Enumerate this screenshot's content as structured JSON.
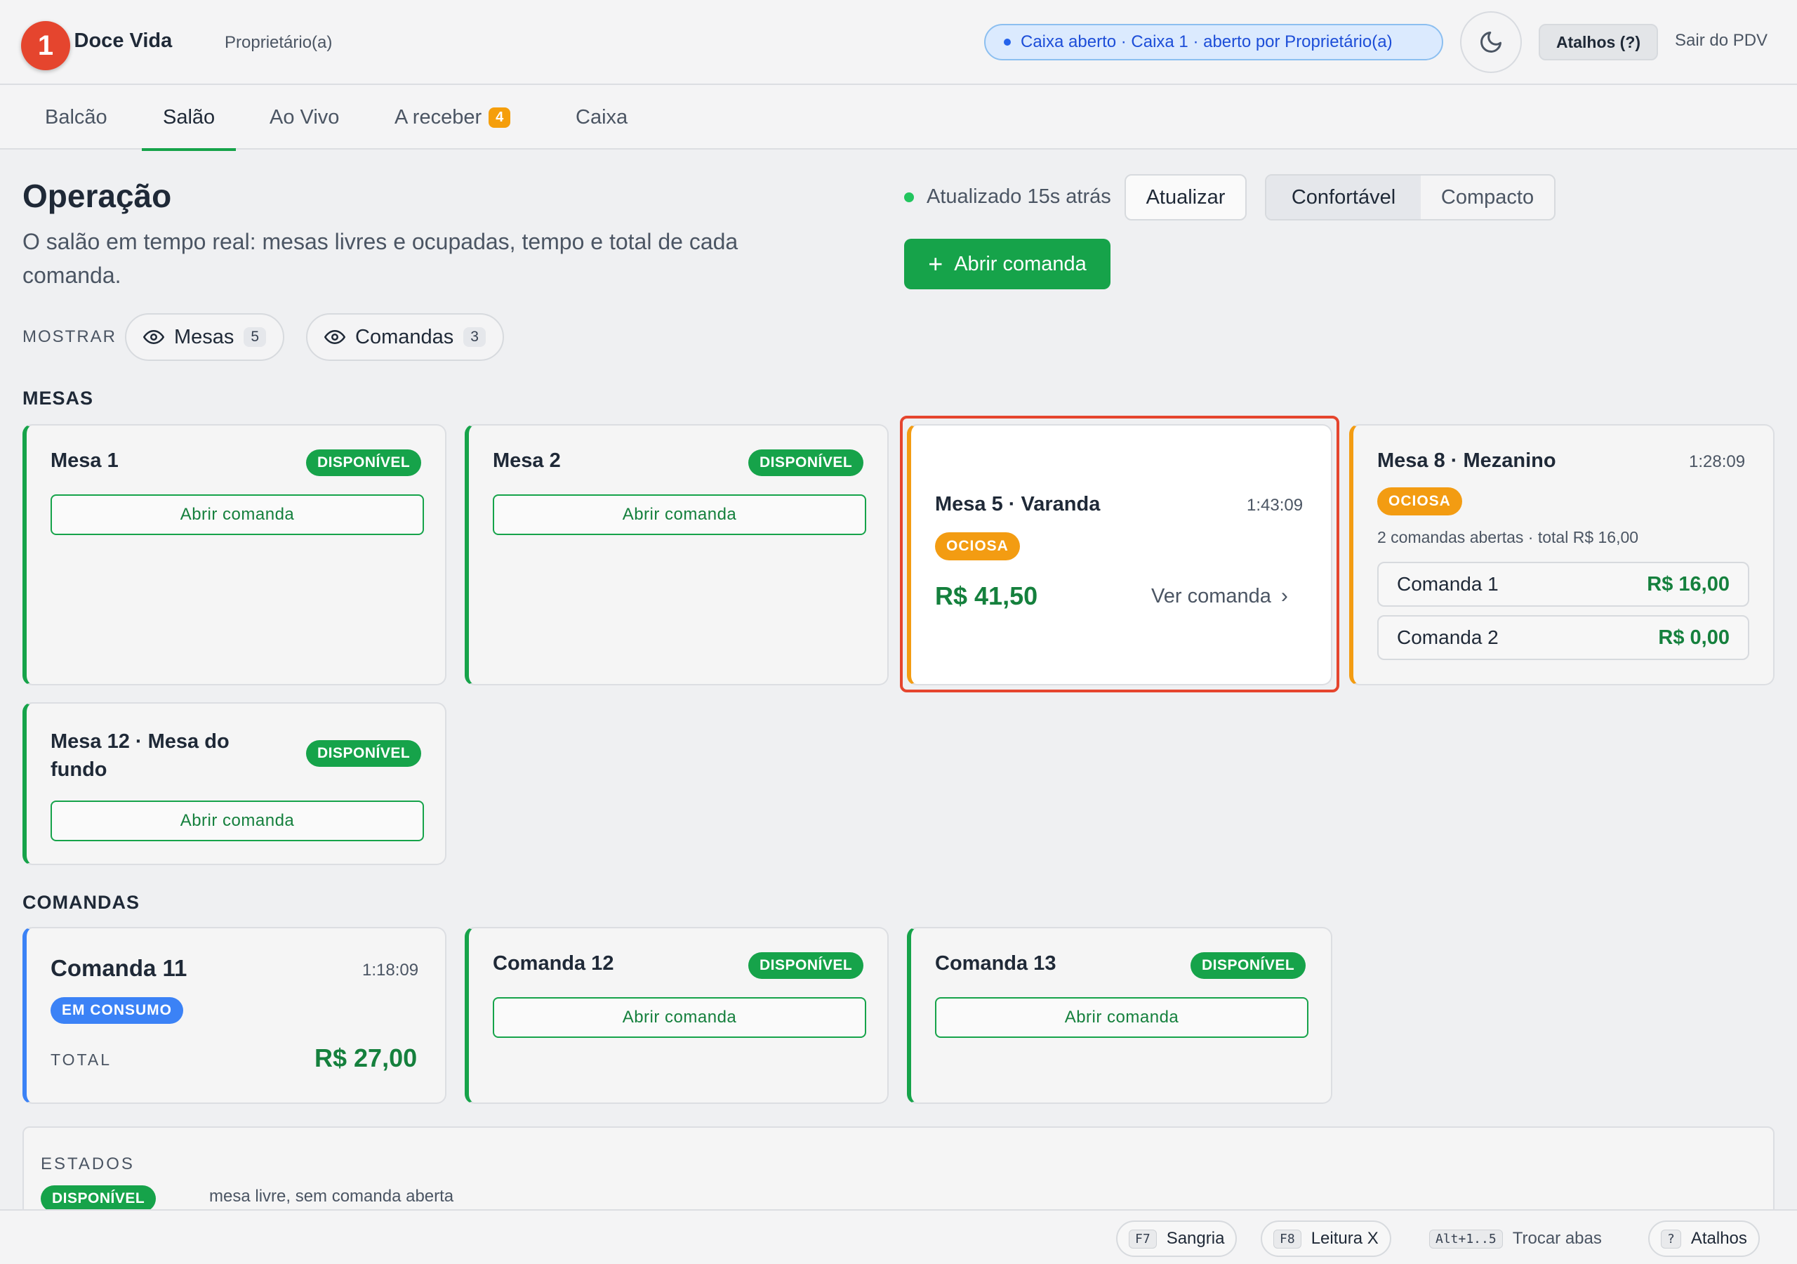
{
  "header": {
    "brand": "ria Doce Vida",
    "role": "Proprietário(a)",
    "step_marker": "1",
    "caixa_status": "Caixa aberto · Caixa 1 · aberto por Proprietário(a)",
    "shortcuts_label": "Atalhos (?)",
    "logout_label": "Sair do PDV"
  },
  "tabs": [
    {
      "label": "Balcão"
    },
    {
      "label": "Salão",
      "active": true
    },
    {
      "label": "Ao Vivo"
    },
    {
      "label": "A receber",
      "badge": "4"
    },
    {
      "label": "Caixa"
    }
  ],
  "page": {
    "title": "Operação",
    "subtitle": "O salão em tempo real: mesas livres e ocupadas, tempo e total de cada comanda.",
    "updated": "Atualizado 15s atrás",
    "refresh_label": "Atualizar",
    "density_options": [
      "Confortável",
      "Compacto"
    ],
    "density_selected": "Confortável",
    "open_comanda_label": "Abrir comanda"
  },
  "filters": {
    "label": "MOSTRAR",
    "mesas": {
      "label": "Mesas",
      "count": "5"
    },
    "comandas": {
      "label": "Comandas",
      "count": "3"
    }
  },
  "mesas_section": "MESAS",
  "mesas": [
    {
      "name": "Mesa 1",
      "status": "DISPONÍVEL",
      "action": "Abrir comanda"
    },
    {
      "name": "Mesa 2",
      "status": "DISPONÍVEL",
      "action": "Abrir comanda"
    },
    {
      "name": "Mesa 5 · Varanda",
      "status": "OCIOSA",
      "time": "1:43:09",
      "total": "R$ 41,50",
      "action": "Ver comanda"
    },
    {
      "name": "Mesa 8 · Mezanino",
      "status": "OCIOSA",
      "time": "1:28:09",
      "summary": "2 comandas abertas · total R$ 16,00",
      "comandas": [
        {
          "name": "Comanda 1",
          "value": "R$ 16,00"
        },
        {
          "name": "Comanda 2",
          "value": "R$ 0,00"
        }
      ]
    },
    {
      "name_line1": "Mesa 12 · Mesa do",
      "name_line2": "fundo",
      "status": "DISPONÍVEL",
      "action": "Abrir comanda"
    }
  ],
  "comandas_section": "COMANDAS",
  "comandas": [
    {
      "name": "Comanda 11",
      "status": "EM CONSUMO",
      "time": "1:18:09",
      "total_label": "TOTAL",
      "total": "R$ 27,00"
    },
    {
      "name": "Comanda 12",
      "status": "DISPONÍVEL",
      "action": "Abrir comanda"
    },
    {
      "name": "Comanda 13",
      "status": "DISPONÍVEL",
      "action": "Abrir comanda"
    }
  ],
  "estados": {
    "label": "ESTADOS",
    "items": [
      {
        "status": "DISPONÍVEL",
        "desc": "mesa livre, sem comanda aberta"
      }
    ]
  },
  "footer": {
    "sangria": {
      "key": "F7",
      "label": "Sangria"
    },
    "leitura": {
      "key": "F8",
      "label": "Leitura X"
    },
    "trocar": {
      "key": "Alt+1..5",
      "label": "Trocar abas"
    },
    "atalhos": {
      "key": "?",
      "label": "Atalhos"
    }
  },
  "colors": {
    "accent_green": "#16a34a",
    "idle_orange": "#f39c12",
    "consuming_blue": "#3b82f6",
    "highlight_red": "#e5452e"
  }
}
